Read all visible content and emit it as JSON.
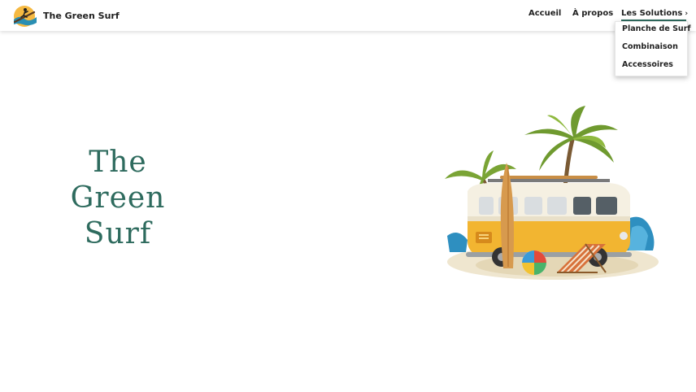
{
  "header": {
    "brand": "The Green Surf",
    "logo_icon": "surfer-logo-icon",
    "nav": [
      {
        "label": "Accueil"
      },
      {
        "label": "À propos"
      },
      {
        "label": "Les Solutions",
        "icon": "chevron-right-icon"
      }
    ],
    "dropdown": [
      "Planche de Surf",
      "Combinaison",
      "Accessoires"
    ]
  },
  "hero": {
    "title_lines": [
      "The",
      "Green",
      "Surf"
    ],
    "illustration": "surf-van-beach-illustration"
  },
  "colors": {
    "brand_green": "#2e6b5e",
    "van_yellow": "#f2b531"
  }
}
